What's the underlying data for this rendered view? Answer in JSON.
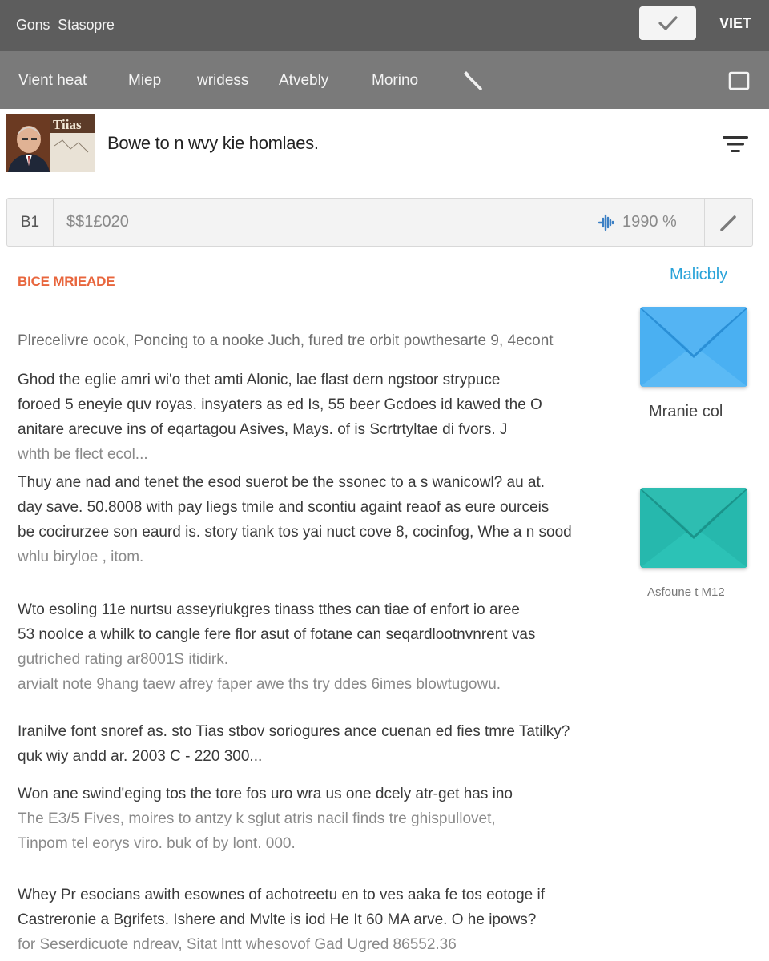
{
  "topbar": {
    "brand_a": "Gons",
    "brand_b": "Stasopre",
    "right_label": "VIET"
  },
  "nav": {
    "items": [
      "Vient heat",
      "Miep",
      "wridess",
      "Atvebly",
      "Morino"
    ]
  },
  "header": {
    "avatar_text": "Tiias",
    "title": "Bowe to n wvy kie homlaes."
  },
  "field": {
    "prefix": "B1",
    "amount": "$$1£020",
    "percent": "1990 %"
  },
  "section": {
    "title": "BICE MRIEADE",
    "link": "Malicbly"
  },
  "paragraphs": [
    {
      "lines": [
        "Plrecelivre ocok, Poncing to a nooke Juch, fured tre orbit powthesarte 9, 4econt"
      ]
    },
    {
      "lines": [
        "Ghod the eglie amri wi'o thet amti Alonic, lae flast dern ngstoor strypuce",
        "foroed 5 eneyie quv royas. insyaters as ed Is, 55 beer Gcdoes id kawed the O",
        "anitare arecuve ins of eqartagou Asives, Mays. of is Scrtrtyltae di fvors. J",
        "whth be flect ecol..."
      ]
    },
    {
      "lines": [
        "Thuy ane nad and tenet the esod suerot be the ssonec to a s wanicowl? au at.",
        "day save. 50.8008 with pay liegs tmile and scontiu againt reaof as eure ourceis",
        "be cocirurzee son eaurd is. story tiank tos yai nuct cove 8, cocinfog, Whe a n sood",
        "whlu biryloe , itom."
      ]
    },
    {
      "lines": [
        "Wto esoling 11e nurtsu asseyriukgres tinass tthes can tiae of enfort io aree",
        "53 noolce a whilk to cangle fere flor asut of fotane can seqardlootnvnrent vas",
        "gutriched rating ar8001S itidirk.",
        "arvialt note 9hang taew afrey faper awe ths try ddes 6imes blowtugowu."
      ]
    },
    {
      "lines": [
        "Iranilve font snoref as. sto Tias stbov soriogures ance cuenan ed fies tmre Tatilky?",
        "quk wiy andd ar. 2003 C - 220 300..."
      ]
    },
    {
      "lines": [
        "Won ane swind'eging tos the tore fos uro wra us one dcely atr-get has ino",
        "The E3/5 Fives, moires to antzy k sglut atris nacil finds tre ghispullovet,",
        "Tinpom tel eorys viro. buk of by lont. 000."
      ]
    },
    {
      "lines": [
        "Whey Pr esocians awith esownes of achotreetu en to ves aaka fe tos eotoge if",
        "Castreronie a Bgrifets. Ishere and Mvlte is iod He It 60 MA arve. O he ipows?",
        "for Seserdicuote ndreav, Sitat lntt whesovof Gad Ugred 86552.36"
      ]
    }
  ],
  "tiles": [
    {
      "label": "Mranie col",
      "color": "#4ab0f2",
      "icon": "envelope-icon"
    },
    {
      "caption": "Asfoune t M12",
      "color": "#26b8ad",
      "icon": "envelope-icon"
    }
  ]
}
